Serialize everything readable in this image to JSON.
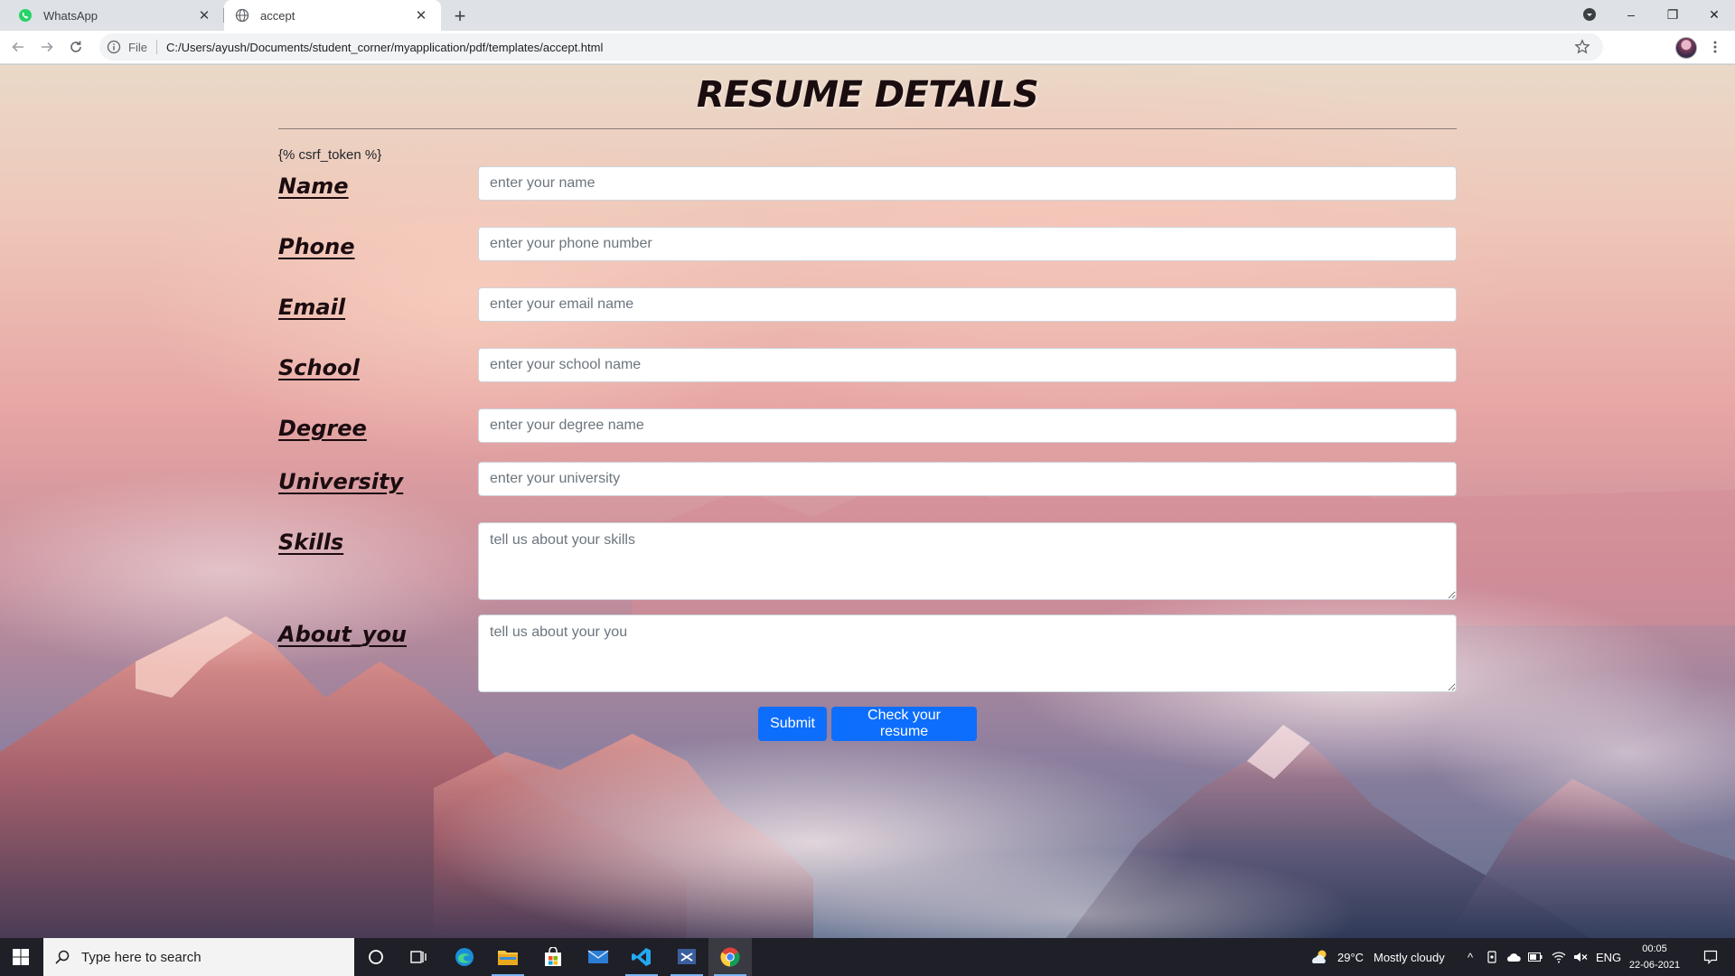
{
  "browser": {
    "tabs": [
      {
        "title": "WhatsApp",
        "close_glyph": "✕",
        "favicon": "whatsapp-icon",
        "active": false
      },
      {
        "title": "accept",
        "close_glyph": "✕",
        "favicon": "globe-icon",
        "active": true
      }
    ],
    "new_tab_glyph": "+",
    "window_controls": {
      "minimize": "–",
      "restore": "❐",
      "close": "✕"
    },
    "omnibox": {
      "scheme_label": "File",
      "url": "C:/Users/ayush/Documents/student_corner/myapplication/pdf/templates/accept.html"
    }
  },
  "page": {
    "heading": "RESUME DETAILS",
    "csrf_text": "{% csrf_token %}",
    "fields": [
      {
        "label": "Name",
        "placeholder": "enter your name",
        "value": ""
      },
      {
        "label": "Phone",
        "placeholder": "enter your phone number",
        "value": ""
      },
      {
        "label": "Email",
        "placeholder": "enter your email name",
        "value": ""
      },
      {
        "label": "School",
        "placeholder": "enter your school name",
        "value": ""
      },
      {
        "label": "Degree",
        "placeholder": "enter your degree name",
        "value": ""
      },
      {
        "label": "University",
        "placeholder": "enter your university",
        "value": ""
      },
      {
        "label": "Skills",
        "placeholder": "tell us about your skills",
        "value": ""
      },
      {
        "label": "About_you",
        "placeholder": "tell us about your you",
        "value": ""
      }
    ],
    "buttons": {
      "submit": "Submit",
      "check": "Check your resume"
    },
    "colors": {
      "button": "#0d6efd",
      "heading": "#1a0d10"
    }
  },
  "taskbar": {
    "search_placeholder": "Type here to search",
    "weather": {
      "temperature": "29°C",
      "condition": "Mostly cloudy"
    },
    "language": "ENG",
    "time": "00:05",
    "date": "22-06-2021",
    "pinned_apps": [
      "cortana-icon",
      "task-view-icon",
      "edge-icon",
      "file-explorer-icon",
      "store-icon",
      "mail-icon",
      "vscode-icon",
      "snipping-tool-icon",
      "chrome-icon"
    ]
  }
}
